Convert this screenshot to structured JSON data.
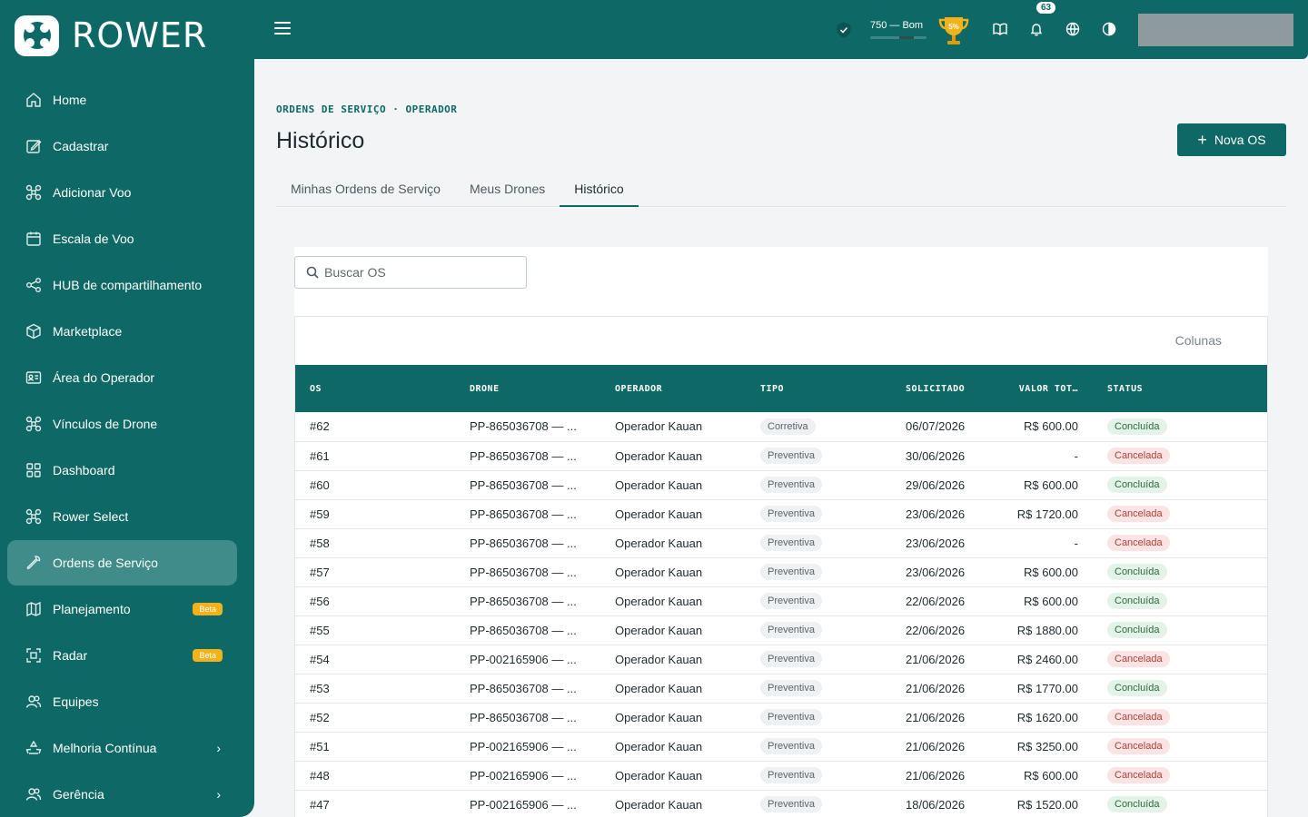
{
  "brand": {
    "name": "ROWER"
  },
  "sidebar": {
    "items": [
      {
        "label": "Home",
        "icon": "home-icon"
      },
      {
        "label": "Cadastrar",
        "icon": "edit-icon"
      },
      {
        "label": "Adicionar Voo",
        "icon": "drone-icon"
      },
      {
        "label": "Escala de Voo",
        "icon": "calendar-icon"
      },
      {
        "label": "HUB de compartilhamento",
        "icon": "share-icon"
      },
      {
        "label": "Marketplace",
        "icon": "box-icon"
      },
      {
        "label": "Área do Operador",
        "icon": "id-card-icon"
      },
      {
        "label": "Vínculos de Drone",
        "icon": "drone-icon"
      },
      {
        "label": "Dashboard",
        "icon": "grid-icon"
      },
      {
        "label": "Rower Select",
        "icon": "drone-icon"
      },
      {
        "label": "Ordens de Serviço",
        "icon": "wrench-icon",
        "active": true
      },
      {
        "label": "Planejamento",
        "icon": "map-icon",
        "badge": "Beta"
      },
      {
        "label": "Radar",
        "icon": "scan-icon",
        "badge": "Beta"
      },
      {
        "label": "Equipes",
        "icon": "users-icon"
      },
      {
        "label": "Melhoria Contínua",
        "icon": "recycle-icon",
        "chevron": true
      },
      {
        "label": "Gerência",
        "icon": "users-icon",
        "chevron": true
      }
    ]
  },
  "topbar": {
    "score_text": "750 — Bom",
    "score_level": 0.5,
    "trophy_label": "5%",
    "notifications_count": "63"
  },
  "page": {
    "breadcrumb": "ORDENS DE SERVIÇO · OPERADOR",
    "title": "Histórico",
    "new_button": "Nova OS",
    "tabs": [
      "Minhas Ordens de Serviço",
      "Meus Drones",
      "Histórico"
    ],
    "active_tab": 2,
    "search_placeholder": "Buscar OS",
    "columns_button": "Colunas"
  },
  "table": {
    "headers": [
      "OS",
      "DRONE",
      "OPERADOR",
      "TIPO",
      "SOLICITADO",
      "VALOR TOT…",
      "STATUS"
    ],
    "rows": [
      {
        "os": "#62",
        "drone": "PP-865036708 — ...",
        "operador": "Operador Kauan",
        "tipo": "Corretiva",
        "solicitado": "06/07/2026",
        "valor": "R$ 600.00",
        "status": "Concluída"
      },
      {
        "os": "#61",
        "drone": "PP-865036708 — ...",
        "operador": "Operador Kauan",
        "tipo": "Preventiva",
        "solicitado": "30/06/2026",
        "valor": "-",
        "status": "Cancelada"
      },
      {
        "os": "#60",
        "drone": "PP-865036708 — ...",
        "operador": "Operador Kauan",
        "tipo": "Preventiva",
        "solicitado": "29/06/2026",
        "valor": "R$ 600.00",
        "status": "Concluída"
      },
      {
        "os": "#59",
        "drone": "PP-865036708 — ...",
        "operador": "Operador Kauan",
        "tipo": "Preventiva",
        "solicitado": "23/06/2026",
        "valor": "R$ 1720.00",
        "status": "Cancelada"
      },
      {
        "os": "#58",
        "drone": "PP-865036708 — ...",
        "operador": "Operador Kauan",
        "tipo": "Preventiva",
        "solicitado": "23/06/2026",
        "valor": "-",
        "status": "Cancelada"
      },
      {
        "os": "#57",
        "drone": "PP-865036708 — ...",
        "operador": "Operador Kauan",
        "tipo": "Preventiva",
        "solicitado": "23/06/2026",
        "valor": "R$ 600.00",
        "status": "Concluída"
      },
      {
        "os": "#56",
        "drone": "PP-865036708 — ...",
        "operador": "Operador Kauan",
        "tipo": "Preventiva",
        "solicitado": "22/06/2026",
        "valor": "R$ 600.00",
        "status": "Concluída"
      },
      {
        "os": "#55",
        "drone": "PP-865036708 — ...",
        "operador": "Operador Kauan",
        "tipo": "Preventiva",
        "solicitado": "22/06/2026",
        "valor": "R$ 1880.00",
        "status": "Concluída"
      },
      {
        "os": "#54",
        "drone": "PP-002165906 — ...",
        "operador": "Operador Kauan",
        "tipo": "Preventiva",
        "solicitado": "21/06/2026",
        "valor": "R$ 2460.00",
        "status": "Cancelada"
      },
      {
        "os": "#53",
        "drone": "PP-865036708 — ...",
        "operador": "Operador Kauan",
        "tipo": "Preventiva",
        "solicitado": "21/06/2026",
        "valor": "R$ 1770.00",
        "status": "Concluída"
      },
      {
        "os": "#52",
        "drone": "PP-865036708 — ...",
        "operador": "Operador Kauan",
        "tipo": "Preventiva",
        "solicitado": "21/06/2026",
        "valor": "R$ 1620.00",
        "status": "Cancelada"
      },
      {
        "os": "#51",
        "drone": "PP-002165906 — ...",
        "operador": "Operador Kauan",
        "tipo": "Preventiva",
        "solicitado": "21/06/2026",
        "valor": "R$ 3250.00",
        "status": "Cancelada"
      },
      {
        "os": "#48",
        "drone": "PP-002165906 — ...",
        "operador": "Operador Kauan",
        "tipo": "Preventiva",
        "solicitado": "21/06/2026",
        "valor": "R$ 600.00",
        "status": "Cancelada"
      },
      {
        "os": "#47",
        "drone": "PP-002165906 — ...",
        "operador": "Operador Kauan",
        "tipo": "Preventiva",
        "solicitado": "18/06/2026",
        "valor": "R$ 1520.00",
        "status": "Concluída"
      }
    ]
  },
  "colors": {
    "primary": "#0d6866",
    "active_nav": "#3f8c8a",
    "beta": "#f3b21a"
  }
}
